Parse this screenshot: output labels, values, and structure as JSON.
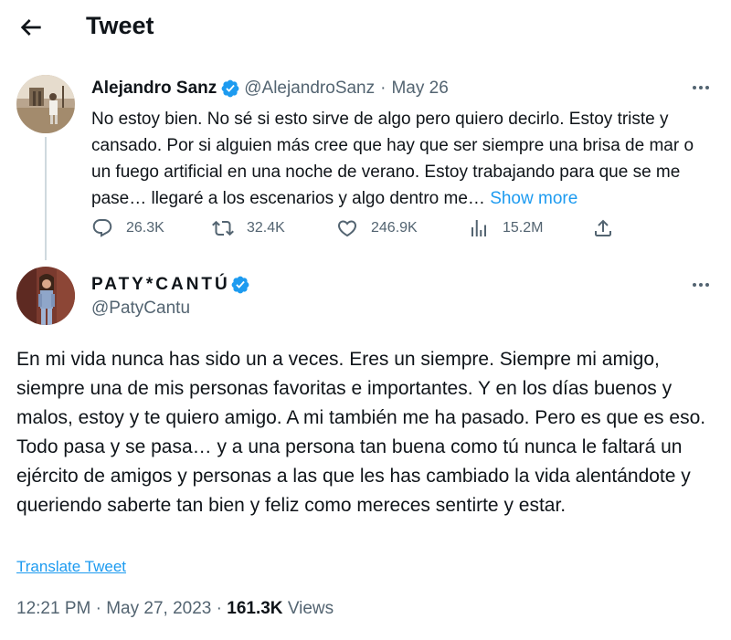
{
  "header": {
    "title": "Tweet",
    "back_icon": "arrow-left-icon"
  },
  "colors": {
    "accent": "#1d9bf0",
    "text": "#0f1419",
    "muted": "#536471",
    "divider": "#cfd9de"
  },
  "original_tweet": {
    "author_name": "Alejandro Sanz",
    "handle": "@AlejandroSanz",
    "separator": "·",
    "date": "May 26",
    "text": "No estoy bien. No sé si esto sirve de algo pero quiero decirlo. Estoy triste y cansado. Por si alguien más cree que hay que ser siempre una brisa de mar o un fuego artificial en una noche de verano. Estoy trabajando para que se me pase… llegaré a los escenarios y algo dentro me…",
    "show_more": "Show more",
    "stats": {
      "replies": "26.3K",
      "retweets": "32.4K",
      "likes": "246.9K",
      "views": "15.2M"
    }
  },
  "reply_tweet": {
    "author_name": "PATY*CANTÚ",
    "handle": "@PatyCantu",
    "text": "En mi vida nunca has sido un a veces. Eres un siempre. Siempre mi amigo, siempre una de mis personas favoritas e importantes. Y en los días buenos y malos, estoy y te quiero amigo. A mi también me ha pasado. Pero es que es eso. Todo pasa y se pasa… y a una persona tan buena como tú nunca le faltará un ejército de amigos y personas a las que les has cambiado la vida alentándote y queriendo saberte tan bien y feliz como mereces sentirte y estar.",
    "translate_label": "Translate Tweet",
    "time": "12:21 PM",
    "dot": "·",
    "date": "May 27, 2023",
    "views_count": "161.3K",
    "views_label": "Views"
  }
}
